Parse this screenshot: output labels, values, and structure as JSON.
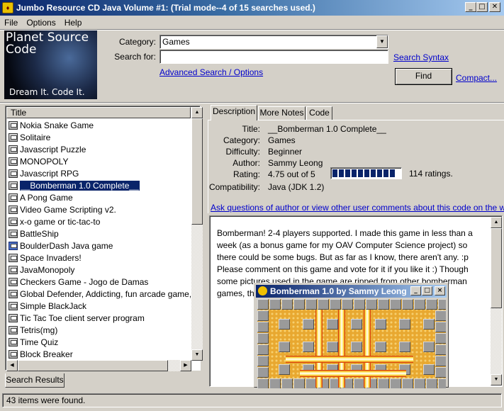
{
  "window": {
    "title": "Jumbo Resource CD Java Volume #1: (Trial mode--4 of 15 searches used.)",
    "minimize": "_",
    "maximize": "□",
    "close": "✕"
  },
  "menu": {
    "file": "File",
    "options": "Options",
    "help": "Help"
  },
  "logo": {
    "text": "Planet Source Code",
    "slogan": "Dream It.  Code It."
  },
  "search": {
    "category_label": "Category:",
    "category_value": "Games",
    "search_for_label": "Search for:",
    "search_value": "",
    "syntax_link": "Search Syntax",
    "advanced_link": "Advanced Search / Options",
    "find_button": "Find",
    "compact_link": "Compact..."
  },
  "results": {
    "column_header": "Title",
    "items": [
      {
        "title": "Nokia Snake Game",
        "icon": "code-file-icon"
      },
      {
        "title": "Solitaire",
        "icon": "code-file-icon"
      },
      {
        "title": "Javascript Puzzle",
        "icon": "code-file-icon"
      },
      {
        "title": "MONOPOLY",
        "icon": "code-file-icon"
      },
      {
        "title": "Javascript RPG",
        "icon": "code-file-icon"
      },
      {
        "title": "__Bomberman 1.0 Complete__",
        "icon": "code-file-icon",
        "selected": true
      },
      {
        "title": "A Pong Game",
        "icon": "code-file-icon"
      },
      {
        "title": "Video Game Scripting v2.",
        "icon": "code-file-icon"
      },
      {
        "title": "x-o game  or tic-tac-to",
        "icon": "code-file-icon"
      },
      {
        "title": "BattleShip",
        "icon": "code-file-icon"
      },
      {
        "title": "BoulderDash Java game",
        "icon": "java-file-icon"
      },
      {
        "title": "Space Invaders!",
        "icon": "code-file-icon"
      },
      {
        "title": "JavaMonopoly",
        "icon": "code-file-icon"
      },
      {
        "title": "Checkers Game - Jogo de Damas",
        "icon": "code-file-icon"
      },
      {
        "title": "Global Defender, Addicting, fun arcade game, Upc",
        "icon": "code-file-icon"
      },
      {
        "title": "Simple BlackJack",
        "icon": "code-file-icon"
      },
      {
        "title": "Tic Tac Toe client server program",
        "icon": "code-file-icon"
      },
      {
        "title": "Tetris(mg)",
        "icon": "code-file-icon"
      },
      {
        "title": "Time Quiz",
        "icon": "code-file-icon"
      },
      {
        "title": "Block Breaker",
        "icon": "code-file-icon"
      }
    ],
    "tab_label": "Search Results"
  },
  "detail_tabs": {
    "description": "Description",
    "more_notes": "More Notes",
    "code": "Code"
  },
  "details": {
    "title_label": "Title:",
    "title_value": "__Bomberman 1.0 Complete__",
    "category_label": "Category:",
    "category_value": "Games",
    "difficulty_label": "Difficulty:",
    "difficulty_value": "Beginner",
    "author_label": "Author:",
    "author_value": "Sammy Leong",
    "rating_label": "Rating:",
    "rating_value": "4.75 out of 5",
    "rating_fraction": 0.95,
    "rating_count": "114 ratings.",
    "compat_label": "Compatibility:",
    "compat_value": "Java (JDK 1.2)",
    "comments_link": "Ask questions of author or view other user comments about this code on the web..."
  },
  "description": {
    "text": "Bomberman! 2-4 players supported. I made this game in less than a week (as a bonus game for my OAV Computer Science project) so there could be some bugs. But as far as I know, there aren't any. :p Please comment on this game and vote for it if you like it :) Though some pictures used in the game are ripped from other bomberman games, the complete source and it's logics are by me :)",
    "screenshot_title": "Bomberman 1.0 by Sammy Leong"
  },
  "status": {
    "text": "43 items were found."
  }
}
